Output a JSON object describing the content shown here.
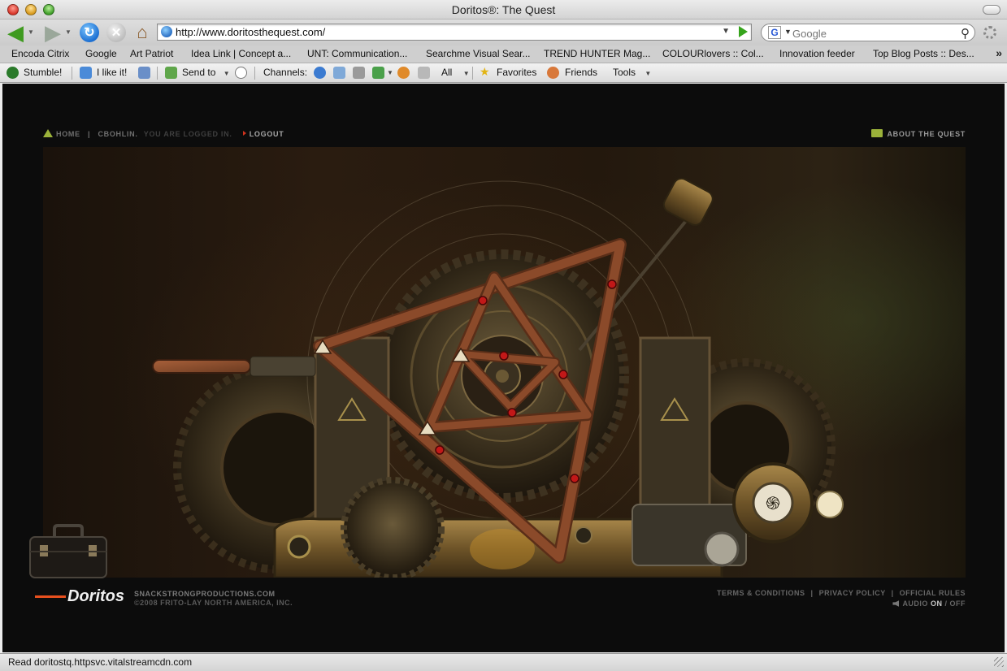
{
  "window": {
    "title": "Doritos®: The Quest"
  },
  "navbar": {
    "url": "http://www.doritosthequest.com/",
    "search_placeholder": "Google",
    "search_engine_letter": "G"
  },
  "bookmarks": [
    "Encoda Citrix",
    "Google",
    "Art Patriot",
    "Idea Link | Concept a...",
    "UNT: Communication...",
    "Searchme Visual Sear...",
    "TREND HUNTER Mag...",
    "COLOURlovers :: Col...",
    "Innovation feeder",
    "Top Blog Posts :: Des..."
  ],
  "stumble": {
    "stumble": "Stumble!",
    "like": "I like it!",
    "send": "Send to",
    "channels": "Channels:",
    "all": "All",
    "favorites": "Favorites",
    "friends": "Friends",
    "tools": "Tools"
  },
  "site": {
    "nav": {
      "home": "HOME",
      "separator": "|",
      "user": "CBOHLIN.",
      "logged_in": "YOU ARE LOGGED IN.",
      "logout": "LOGOUT"
    },
    "about": "ABOUT THE QUEST",
    "footer": {
      "logo": "Doritos",
      "production": "SNACKSTRONGPRODUCTIONS.COM",
      "copyright": "©2008 FRITO-LAY NORTH AMERICA, INC.",
      "terms": "TERMS & CONDITIONS",
      "privacy": "PRIVACY POLICY",
      "rules": "OFFICIAL RULES",
      "link_sep": "|",
      "audio": "AUDIO",
      "audio_on": "ON",
      "audio_sep": "/",
      "audio_off": "OFF"
    }
  },
  "colors": {
    "accent_green": "#9bb23a",
    "logout_red": "#d2331d",
    "puzzle_frame": "#8b4a2a",
    "gem_red": "#c21818"
  },
  "status": {
    "text": "Read doritostq.httpsvc.vitalstreamcdn.com"
  }
}
